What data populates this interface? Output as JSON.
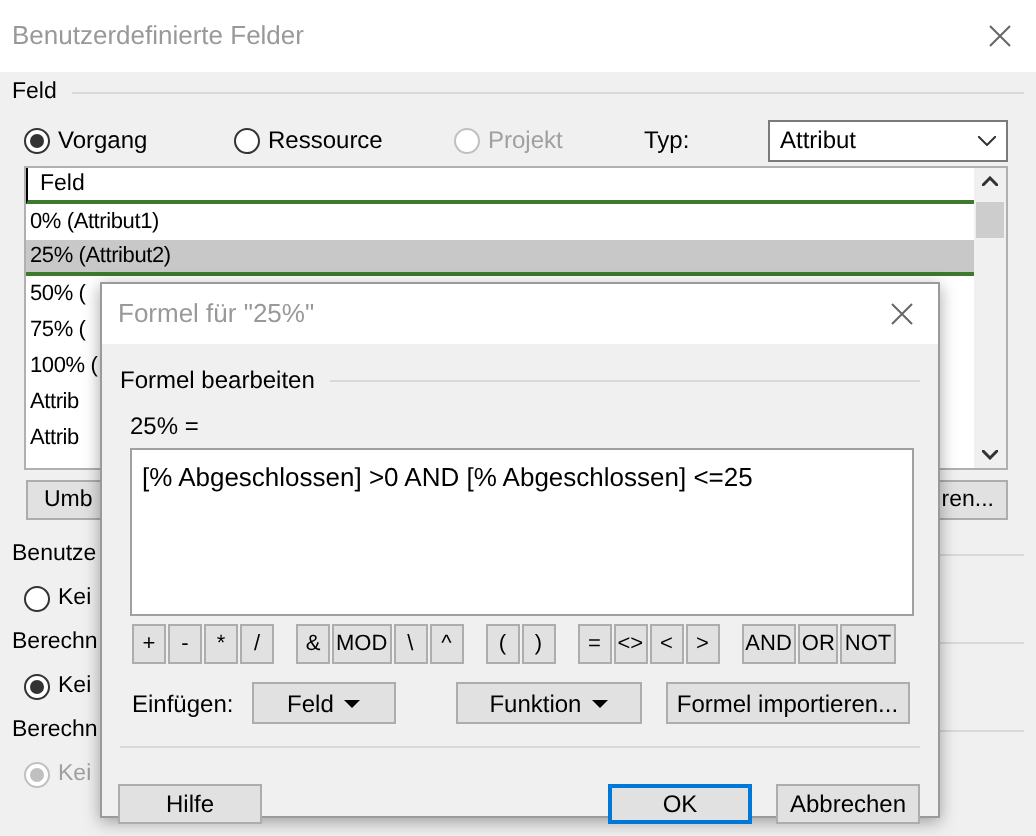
{
  "window": {
    "title": "Benutzerdefinierte Felder"
  },
  "field_group": {
    "label": "Feld",
    "options": [
      {
        "label": "Vorgang",
        "selected": true,
        "disabled": false
      },
      {
        "label": "Ressource",
        "selected": false,
        "disabled": false
      },
      {
        "label": "Projekt",
        "selected": false,
        "disabled": true
      }
    ],
    "type_label": "Typ:",
    "type_value": "Attribut"
  },
  "field_list": {
    "header": "Feld",
    "rows": [
      {
        "label": "0% (Attribut1)",
        "selected": false
      },
      {
        "label": "25% (Attribut2)",
        "selected": true
      },
      {
        "label": "50% (",
        "selected": false
      },
      {
        "label": "75% (",
        "selected": false
      },
      {
        "label": "100% (",
        "selected": false
      },
      {
        "label": "Attrib",
        "selected": false
      },
      {
        "label": "Attrib",
        "selected": false
      }
    ]
  },
  "list_buttons": [
    "Umb",
    "ren..."
  ],
  "sections": [
    {
      "label": "Benutze",
      "radio": {
        "label": "Kei",
        "selected": false,
        "disabled": false
      }
    },
    {
      "label": "Berechn",
      "radio": {
        "label": "Kei",
        "selected": true,
        "disabled": false
      }
    },
    {
      "label": "Berechn",
      "radio": {
        "label": "Kei",
        "selected": true,
        "disabled": true
      }
    }
  ],
  "formula_dialog": {
    "title": "Formel für \"25%\"",
    "group_label": "Formel bearbeiten",
    "expression_label": "25% =",
    "formula": "[% Abgeschlossen] >0 AND [% Abgeschlossen] <=25",
    "operator_groups": [
      [
        "+",
        "-",
        "*",
        "/"
      ],
      [
        "&",
        "MOD",
        "\\",
        "^"
      ],
      [
        "(",
        ")"
      ],
      [
        "=",
        "<>",
        "<",
        ">"
      ],
      [
        "AND",
        "OR",
        "NOT"
      ]
    ],
    "insert_label": "Einfügen:",
    "insert_buttons": [
      {
        "label": "Feld",
        "dropdown": true
      },
      {
        "label": "Funktion",
        "dropdown": true
      },
      {
        "label": "Formel importieren...",
        "dropdown": false
      }
    ],
    "buttons": [
      {
        "label": "Hilfe",
        "default": false
      },
      {
        "label": "OK",
        "default": true
      },
      {
        "label": "Abbrechen",
        "default": false
      }
    ]
  }
}
